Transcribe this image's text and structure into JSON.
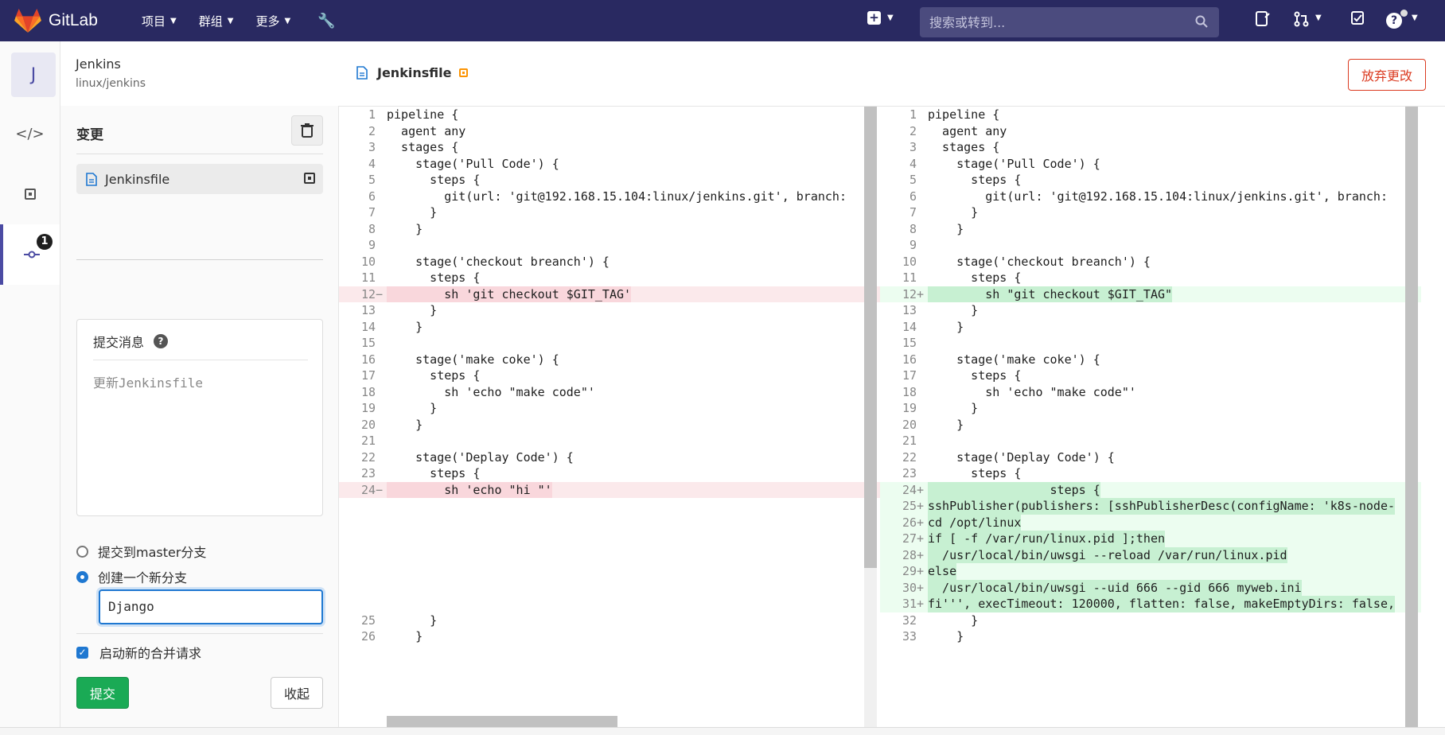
{
  "app": {
    "name": "GitLab"
  },
  "nav": {
    "projects": "项目",
    "groups": "群组",
    "more": "更多",
    "search_placeholder": "搜索或转到..."
  },
  "project": {
    "avatar_letter": "J",
    "name": "Jenkins",
    "path": "linux/jenkins"
  },
  "sidebar": {
    "badge_count": "1"
  },
  "changes_panel": {
    "title": "变更",
    "file": "Jenkinsfile",
    "commit_message_label": "提交消息",
    "commit_message_placeholder": "更新Jenkinsfile",
    "option_master": "提交到master分支",
    "option_new_branch": "创建一个新分支",
    "new_branch_value": "Django",
    "start_mr_label": "启动新的合并请求",
    "commit_button": "提交",
    "collapse_button": "收起"
  },
  "editor": {
    "file": "Jenkinsfile",
    "discard_button": "放弃更改"
  },
  "diff_left": [
    {
      "n": "1",
      "t": "pipeline {",
      "k": ""
    },
    {
      "n": "2",
      "t": "  agent any",
      "k": ""
    },
    {
      "n": "3",
      "t": "  stages {",
      "k": ""
    },
    {
      "n": "4",
      "t": "    stage('Pull Code') {",
      "k": ""
    },
    {
      "n": "5",
      "t": "      steps {",
      "k": ""
    },
    {
      "n": "6",
      "t": "        git(url: 'git@192.168.15.104:linux/jenkins.git', branch:",
      "k": ""
    },
    {
      "n": "7",
      "t": "      }",
      "k": ""
    },
    {
      "n": "8",
      "t": "    }",
      "k": ""
    },
    {
      "n": "9",
      "t": "",
      "k": ""
    },
    {
      "n": "10",
      "t": "    stage('checkout breanch') {",
      "k": ""
    },
    {
      "n": "11",
      "t": "      steps {",
      "k": ""
    },
    {
      "n": "12",
      "t": "        sh 'git checkout $GIT_TAG'",
      "k": "del"
    },
    {
      "n": "13",
      "t": "      }",
      "k": ""
    },
    {
      "n": "14",
      "t": "    }",
      "k": ""
    },
    {
      "n": "15",
      "t": "",
      "k": ""
    },
    {
      "n": "16",
      "t": "    stage('make coke') {",
      "k": ""
    },
    {
      "n": "17",
      "t": "      steps {",
      "k": ""
    },
    {
      "n": "18",
      "t": "        sh 'echo \"make code\"'",
      "k": ""
    },
    {
      "n": "19",
      "t": "      }",
      "k": ""
    },
    {
      "n": "20",
      "t": "    }",
      "k": ""
    },
    {
      "n": "21",
      "t": "",
      "k": ""
    },
    {
      "n": "22",
      "t": "    stage('Deplay Code') {",
      "k": ""
    },
    {
      "n": "23",
      "t": "      steps {",
      "k": ""
    },
    {
      "n": "24",
      "t": "        sh 'echo \"hi \"'",
      "k": "del"
    },
    {
      "n": "",
      "t": "",
      "k": ""
    },
    {
      "n": "",
      "t": "",
      "k": ""
    },
    {
      "n": "",
      "t": "",
      "k": ""
    },
    {
      "n": "",
      "t": "",
      "k": ""
    },
    {
      "n": "",
      "t": "",
      "k": ""
    },
    {
      "n": "",
      "t": "",
      "k": ""
    },
    {
      "n": "",
      "t": "",
      "k": ""
    },
    {
      "n": "25",
      "t": "      }",
      "k": ""
    },
    {
      "n": "26",
      "t": "    }",
      "k": ""
    }
  ],
  "diff_right": [
    {
      "n": "1",
      "t": "pipeline {",
      "k": ""
    },
    {
      "n": "2",
      "t": "  agent any",
      "k": ""
    },
    {
      "n": "3",
      "t": "  stages {",
      "k": ""
    },
    {
      "n": "4",
      "t": "    stage('Pull Code') {",
      "k": ""
    },
    {
      "n": "5",
      "t": "      steps {",
      "k": ""
    },
    {
      "n": "6",
      "t": "        git(url: 'git@192.168.15.104:linux/jenkins.git', branch:",
      "k": ""
    },
    {
      "n": "7",
      "t": "      }",
      "k": ""
    },
    {
      "n": "8",
      "t": "    }",
      "k": ""
    },
    {
      "n": "9",
      "t": "",
      "k": ""
    },
    {
      "n": "10",
      "t": "    stage('checkout breanch') {",
      "k": ""
    },
    {
      "n": "11",
      "t": "      steps {",
      "k": ""
    },
    {
      "n": "12",
      "t": "        sh \"git checkout $GIT_TAG\"",
      "k": "add"
    },
    {
      "n": "13",
      "t": "      }",
      "k": ""
    },
    {
      "n": "14",
      "t": "    }",
      "k": ""
    },
    {
      "n": "15",
      "t": "",
      "k": ""
    },
    {
      "n": "16",
      "t": "    stage('make coke') {",
      "k": ""
    },
    {
      "n": "17",
      "t": "      steps {",
      "k": ""
    },
    {
      "n": "18",
      "t": "        sh 'echo \"make code\"'",
      "k": ""
    },
    {
      "n": "19",
      "t": "      }",
      "k": ""
    },
    {
      "n": "20",
      "t": "    }",
      "k": ""
    },
    {
      "n": "21",
      "t": "",
      "k": ""
    },
    {
      "n": "22",
      "t": "    stage('Deplay Code') {",
      "k": ""
    },
    {
      "n": "23",
      "t": "      steps {",
      "k": ""
    },
    {
      "n": "24",
      "t": "                 steps {",
      "k": "add"
    },
    {
      "n": "25",
      "t": "sshPublisher(publishers: [sshPublisherDesc(configName: 'k8s-node-",
      "k": "add"
    },
    {
      "n": "26",
      "t": "cd /opt/linux",
      "k": "add"
    },
    {
      "n": "27",
      "t": "if [ -f /var/run/linux.pid ];then",
      "k": "add"
    },
    {
      "n": "28",
      "t": "  /usr/local/bin/uwsgi --reload /var/run/linux.pid",
      "k": "add"
    },
    {
      "n": "29",
      "t": "else",
      "k": "add"
    },
    {
      "n": "30",
      "t": "  /usr/local/bin/uwsgi --uid 666 --gid 666 myweb.ini",
      "k": "add"
    },
    {
      "n": "31",
      "t": "fi''', execTimeout: 120000, flatten: false, makeEmptyDirs: false,",
      "k": "add"
    },
    {
      "n": "32",
      "t": "      }",
      "k": ""
    },
    {
      "n": "33",
      "t": "    }",
      "k": ""
    }
  ]
}
